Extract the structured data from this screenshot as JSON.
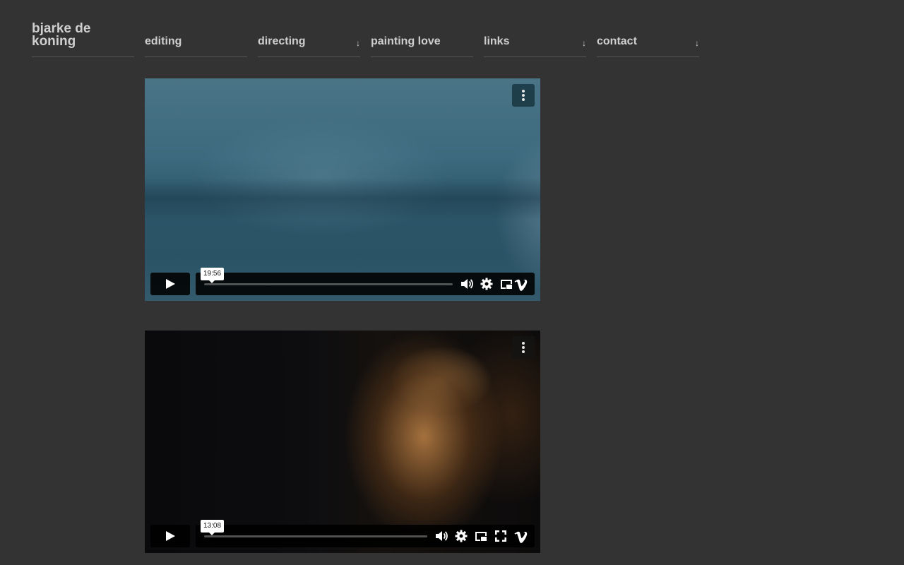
{
  "site": {
    "title": "bjarke de koning"
  },
  "nav": {
    "items": [
      {
        "label": "editing",
        "has_dropdown": false
      },
      {
        "label": "directing",
        "has_dropdown": true
      },
      {
        "label": "painting love",
        "has_dropdown": false
      },
      {
        "label": "links",
        "has_dropdown": true
      },
      {
        "label": "contact",
        "has_dropdown": true
      }
    ],
    "dropdown_glyph": "↓"
  },
  "videos": [
    {
      "duration": "19:56",
      "controls": [
        "play-icon",
        "volume-icon",
        "settings-icon",
        "pip-icon",
        "vimeo-icon"
      ]
    },
    {
      "duration": "13:08",
      "controls": [
        "play-icon",
        "volume-icon",
        "settings-icon",
        "pip-icon",
        "fullscreen-icon",
        "vimeo-icon"
      ]
    }
  ],
  "colors": {
    "background": "#333333",
    "text": "#cfcfcf",
    "player_chrome": "#000000"
  }
}
